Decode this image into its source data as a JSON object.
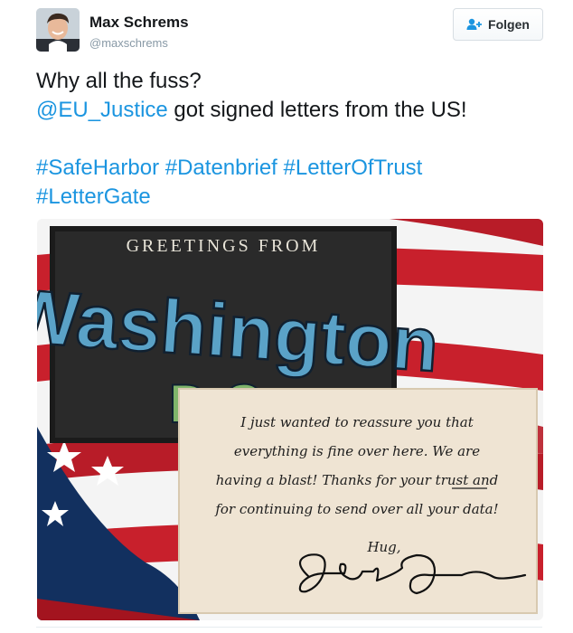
{
  "author": {
    "name": "Max Schrems",
    "handle": "@maxschrems",
    "avatar_icon": "person-avatar"
  },
  "follow_button": {
    "label": "Folgen",
    "icon": "add-user-icon"
  },
  "tweet": {
    "line1": "Why all the fuss?",
    "mention": "@EU_Justice",
    "line2_rest": " got signed letters from the US!",
    "hashtags": [
      "#SafeHarbor",
      "#Datenbrief",
      "#LetterOfTrust",
      "#LetterGate"
    ]
  },
  "media": {
    "postcard_heading": "GREETINGS FROM",
    "postcard_city_word": "Washington",
    "postcard_dc": "D.C.",
    "letter_lines": [
      "I just wanted to reassure you that",
      "everything is fine over here. We are",
      "having a blast! Thanks for your trust and",
      "for continuing to send over all your data!"
    ],
    "letter_underlined_word": "trust",
    "closing": "Hug,"
  },
  "colors": {
    "link": "#1b95e0",
    "text": "#14171a",
    "muted": "#8899a6"
  }
}
